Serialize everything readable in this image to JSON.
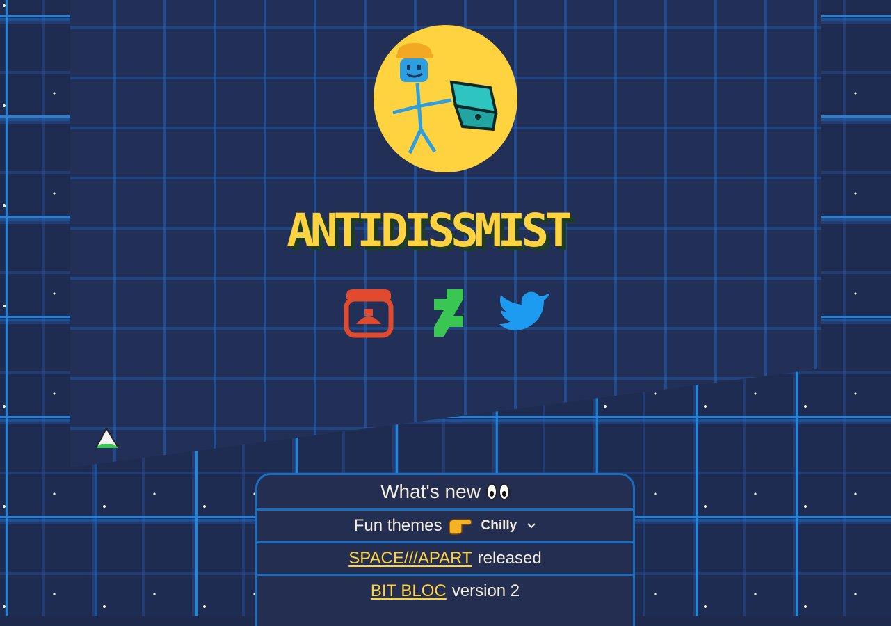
{
  "site": {
    "name": "ANTIDISSMIST",
    "logo_icon": "stick-figure-with-treasure-chest",
    "colors": {
      "accent": "#ffd23f",
      "panel": "#223057",
      "line": "#1f8ee8"
    }
  },
  "social": [
    {
      "icon": "itchio-icon",
      "color": "#e24a2e"
    },
    {
      "icon": "deviantart-icon",
      "color": "#3ac653"
    },
    {
      "icon": "twitter-icon",
      "color": "#1d9bf0"
    }
  ],
  "whats_new": {
    "title": "What's new",
    "title_icon": "eyes-icon",
    "themes": {
      "label": "Fun themes",
      "pointer_icon": "pointing-hand-icon",
      "selected": "Chilly"
    },
    "items": [
      {
        "link": "SPACE///APART",
        "text": "released"
      },
      {
        "link": "BIT BLOC",
        "text": "version 2"
      }
    ]
  }
}
